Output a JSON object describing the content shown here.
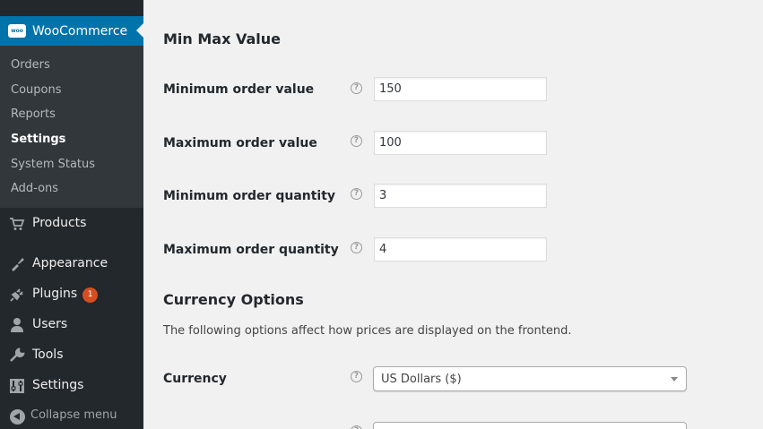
{
  "sidebar": {
    "woocommerce": {
      "label": "WooCommerce",
      "badge": "woo"
    },
    "submenu": [
      "Orders",
      "Coupons",
      "Reports",
      "Settings",
      "System Status",
      "Add-ons"
    ],
    "current_submenu": "Settings",
    "items": [
      {
        "label": "Products",
        "icon": "cart-icon"
      },
      {
        "label": "Appearance",
        "icon": "paintbrush-icon"
      },
      {
        "label": "Plugins",
        "icon": "plug-icon",
        "count": "1"
      },
      {
        "label": "Users",
        "icon": "user-icon"
      },
      {
        "label": "Tools",
        "icon": "wrench-icon"
      },
      {
        "label": "Settings",
        "icon": "sliders-icon"
      }
    ],
    "collapse_label": "Collapse menu"
  },
  "main": {
    "section1_title": "Min Max Value",
    "fields": [
      {
        "label": "Minimum order value",
        "value": "150"
      },
      {
        "label": "Maximum order value",
        "value": "100"
      },
      {
        "label": "Minimum order quantity",
        "value": "3"
      },
      {
        "label": "Maximum order quantity",
        "value": "4"
      }
    ],
    "section2_title": "Currency Options",
    "section2_desc": "The following options affect how prices are displayed on the frontend.",
    "currency_label": "Currency",
    "currency_value": "US Dollars ($)",
    "help_glyph": "?"
  },
  "colors": {
    "sidebar_bg": "#23282d",
    "submenu_bg": "#32373c",
    "active_bg": "#0073aa",
    "badge": "#d54e21",
    "page_bg": "#f1f1f1"
  }
}
